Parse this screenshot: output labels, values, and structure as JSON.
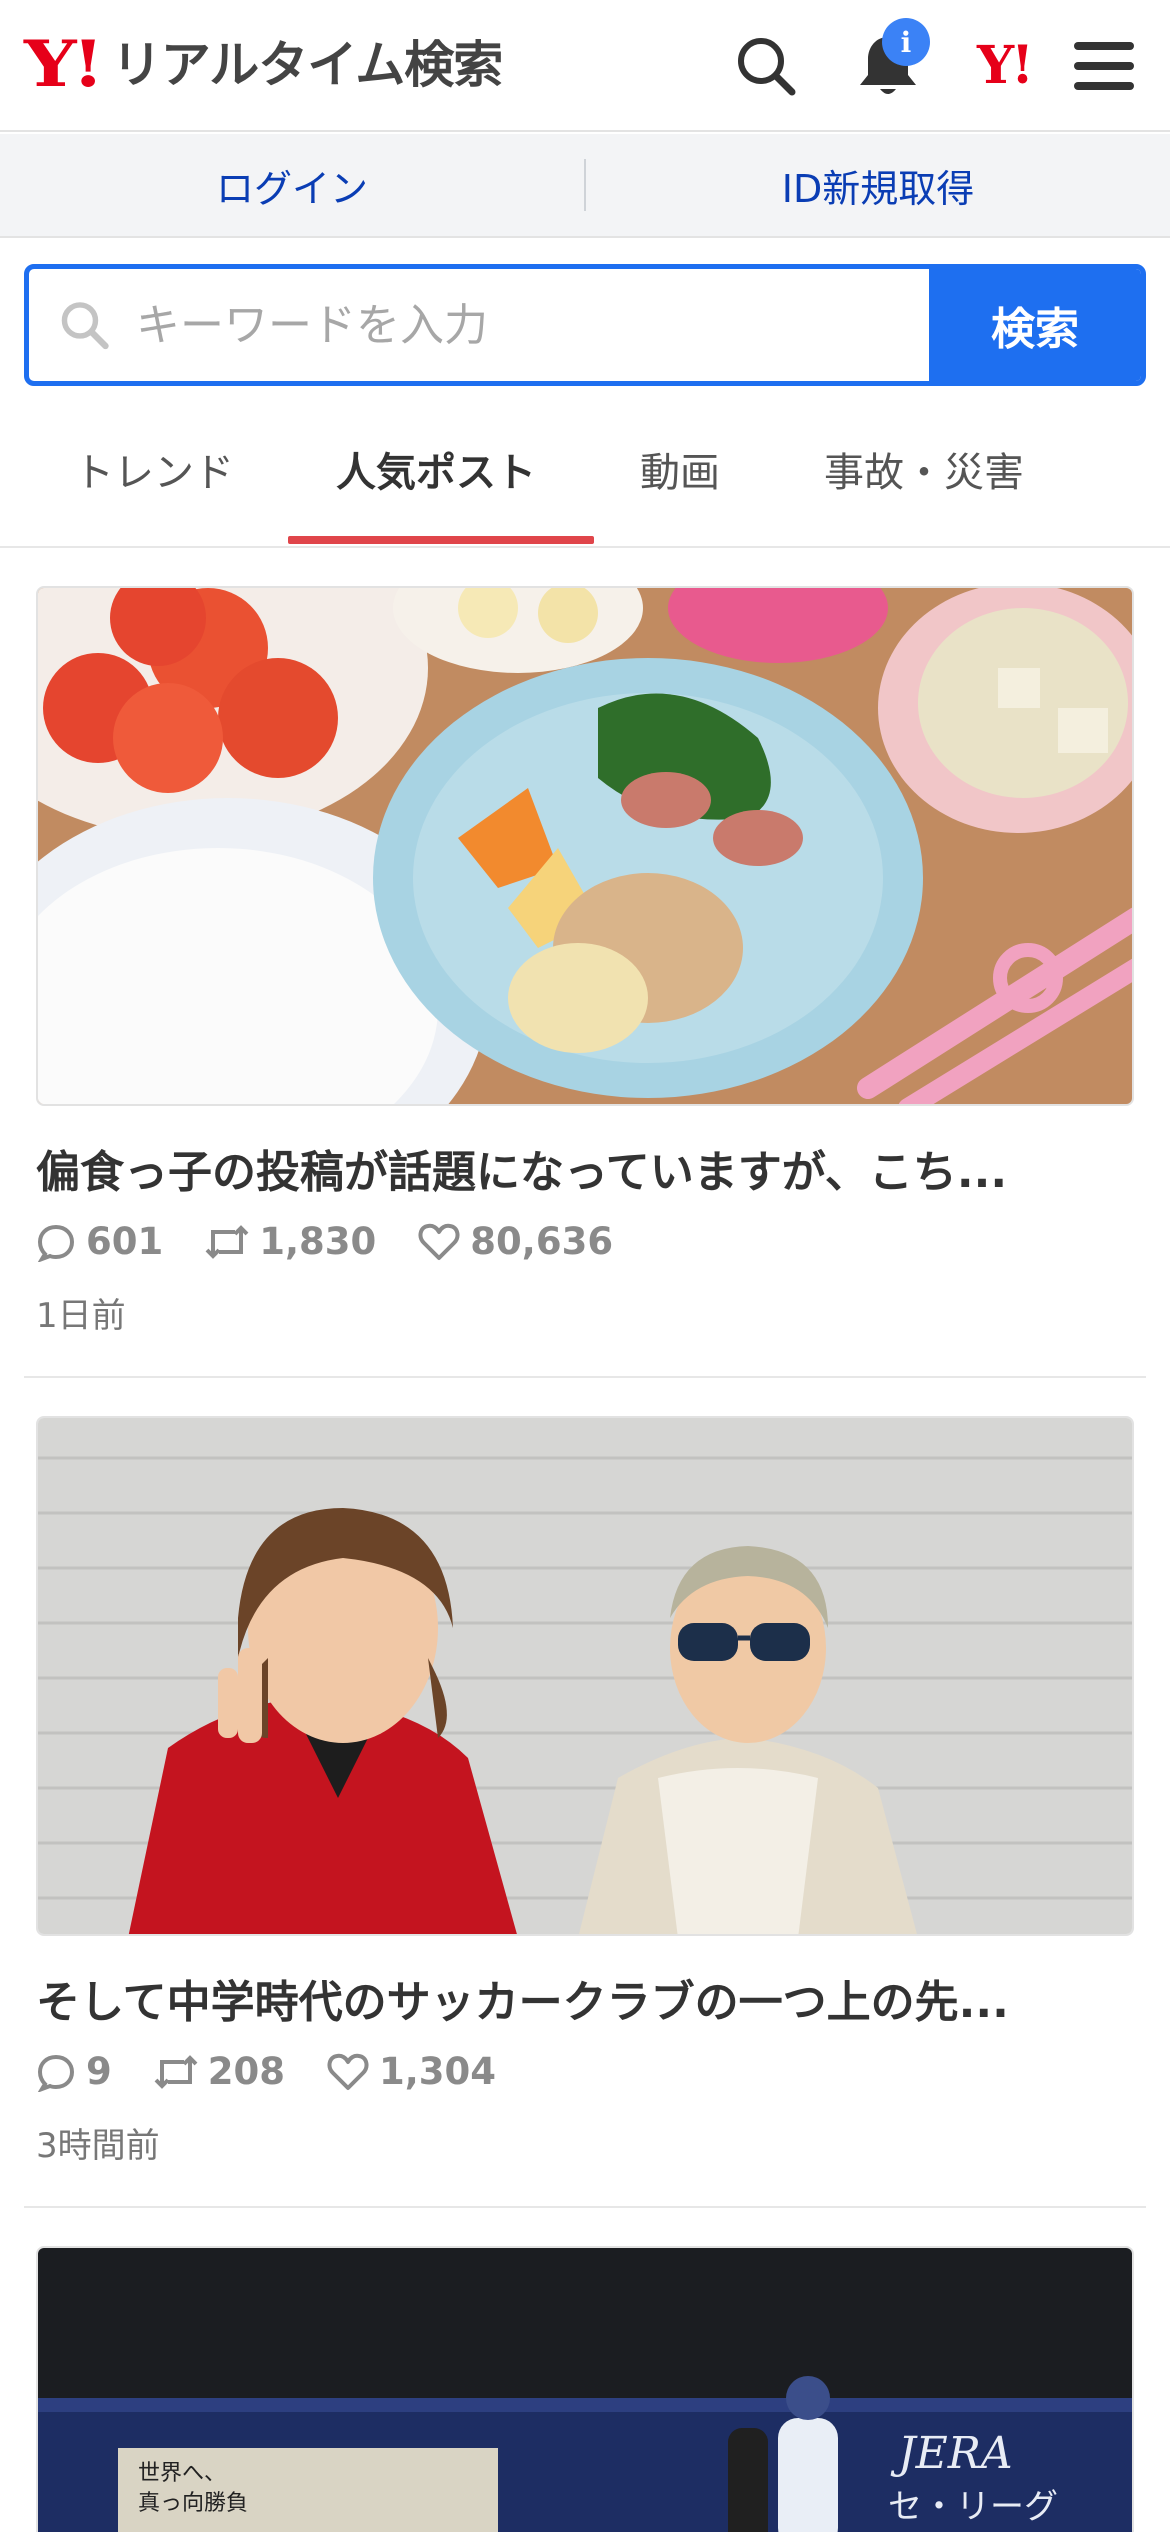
{
  "header": {
    "logo_mark": "Y!",
    "logo_text": "リアルタイム検索",
    "notification_badge": "i",
    "yahoo_icon": "Y!",
    "icons": [
      "search-icon",
      "bell-icon",
      "yahoo-icon",
      "menu-icon"
    ]
  },
  "auth": {
    "login": "ログイン",
    "signup": "ID新規取得"
  },
  "search": {
    "placeholder": "キーワードを入力",
    "button": "検索"
  },
  "tabs": [
    {
      "label": "トレンド",
      "active": false
    },
    {
      "label": "人気ポスト",
      "active": true
    },
    {
      "label": "動画",
      "active": false
    },
    {
      "label": "事故・災害",
      "active": false
    }
  ],
  "posts": [
    {
      "title": "偏食っ子の投稿が話題になっていますが、こち...",
      "replies": "601",
      "reposts": "1,830",
      "likes": "80,636",
      "time": "1日前",
      "image": "food-plate-photo"
    },
    {
      "title": "そして中学時代のサッカークラブの一つ上の先...",
      "replies": "9",
      "reposts": "208",
      "likes": "1,304",
      "time": "3時間前",
      "image": "two-men-photo"
    },
    {
      "image": "baseball-stadium-photo",
      "image_texts": [
        "JERA",
        "セ・リーグ",
        "世界へ、",
        "真っ向勝負"
      ]
    }
  ],
  "colors": {
    "brand_red": "#e60019",
    "link_blue": "#0a3db4",
    "search_blue": "#1e6ff0",
    "tab_accent": "#e0454a",
    "badge_blue": "#3b82f6"
  }
}
